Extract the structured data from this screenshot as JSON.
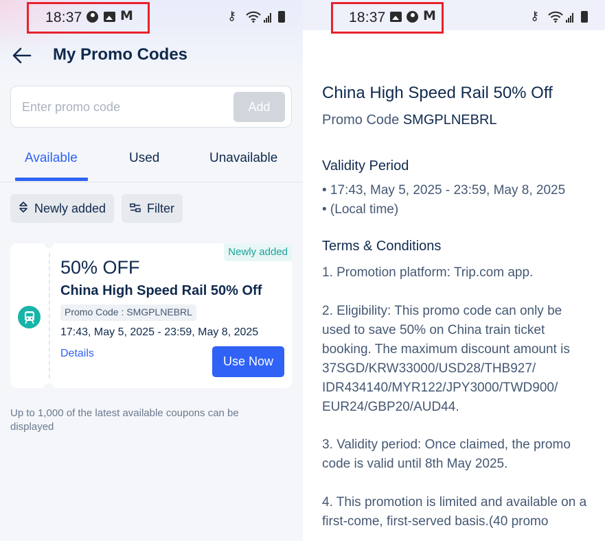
{
  "status_bar": {
    "time": "18:37"
  },
  "left": {
    "header": {
      "title": "My Promo Codes"
    },
    "promo_entry": {
      "placeholder": "Enter promo code",
      "value": "",
      "add_label": "Add"
    },
    "tabs": [
      {
        "label": "Available",
        "active": true
      },
      {
        "label": "Used",
        "active": false
      },
      {
        "label": "Unavailable",
        "active": false
      }
    ],
    "chips": {
      "sort_label": "Newly added",
      "filter_label": "Filter"
    },
    "coupon": {
      "badge": "Newly added",
      "discount": "50% OFF",
      "name": "China High Speed Rail 50% Off",
      "code_label": "Promo Code : SMGPLNEBRL",
      "dates": "17:43, May 5, 2025 - 23:59, May 8, 2025",
      "details_label": "Details",
      "use_now_label": "Use Now"
    },
    "footnote": "Up to 1,000 of the latest available coupons can be displayed"
  },
  "right": {
    "title": "China High Speed Rail 50% Off",
    "code_prefix": "Promo Code",
    "code": "SMGPLNEBRL",
    "validity": {
      "heading": "Validity Period",
      "line1": "• 17:43, May 5, 2025 - 23:59, May 8, 2025",
      "line2": "• (Local time)"
    },
    "terms": {
      "heading": "Terms & Conditions",
      "t1": "1. Promotion platform: Trip.com app.",
      "t2": "2. Eligibility: This promo code can only be used to save 50% on China train ticket booking. The maximum discount amount is 37SGD/KRW33000/USD28/THB927/ IDR434140/MYR122/JPY3000/TWD900/ EUR24/GBP20/AUD44.",
      "t3": "3. Validity period: Once claimed, the promo code is valid until 8th May 2025.",
      "t4": "4. This promotion is limited and available on a first-come, first-served basis.(40 promo"
    }
  },
  "colors": {
    "accent": "#2f62f5",
    "teal": "#18b4a8",
    "highlight": "#e8212d",
    "text": "#0f294d"
  },
  "icons": [
    "back-arrow-icon",
    "sort-icon",
    "filter-icon",
    "train-icon",
    "account-circle-icon",
    "image-icon",
    "gmail-icon",
    "vpn-key-icon",
    "wifi-icon",
    "signal-icon",
    "battery-icon"
  ]
}
